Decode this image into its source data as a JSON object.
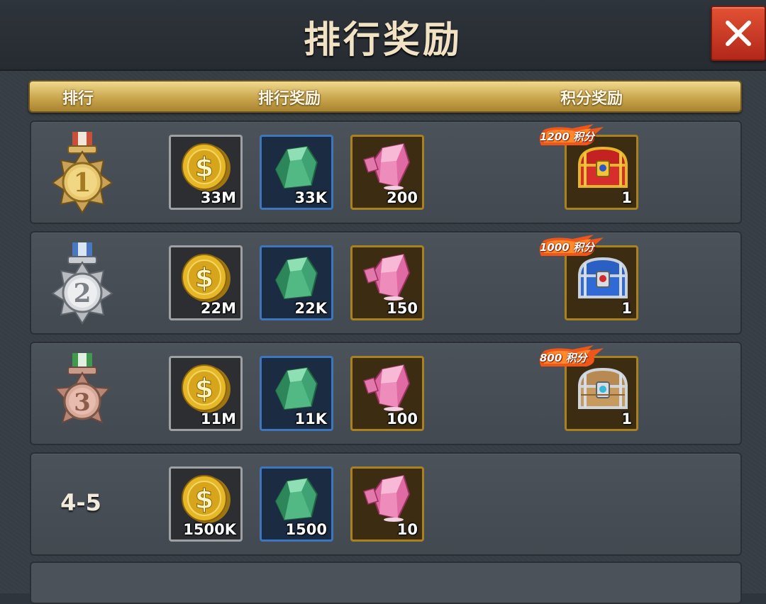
{
  "title": "排行奖励",
  "header": {
    "rank": "排行",
    "rank_reward": "排行奖励",
    "points_reward": "积分奖励"
  },
  "rows": [
    {
      "rank": 1,
      "medal": "gold-medal-icon",
      "gold": "33M",
      "gem": "33K",
      "crystal": "200",
      "chest": {
        "badge": "1200 积分",
        "qty": "1",
        "icon": "red-chest-icon"
      }
    },
    {
      "rank": 2,
      "medal": "silver-medal-icon",
      "gold": "22M",
      "gem": "22K",
      "crystal": "150",
      "chest": {
        "badge": "1000 积分",
        "qty": "1",
        "icon": "blue-chest-icon"
      }
    },
    {
      "rank": 3,
      "medal": "bronze-medal-icon",
      "gold": "11M",
      "gem": "11K",
      "crystal": "100",
      "chest": {
        "badge": "800 积分",
        "qty": "1",
        "icon": "wooden-chest-icon"
      }
    },
    {
      "rank_label": "4-5",
      "gold": "1500K",
      "gem": "1500",
      "crystal": "10"
    }
  ],
  "colors": {
    "gold_bar": "#caa64e",
    "close": "#c83a22",
    "panel": "#383e45"
  }
}
